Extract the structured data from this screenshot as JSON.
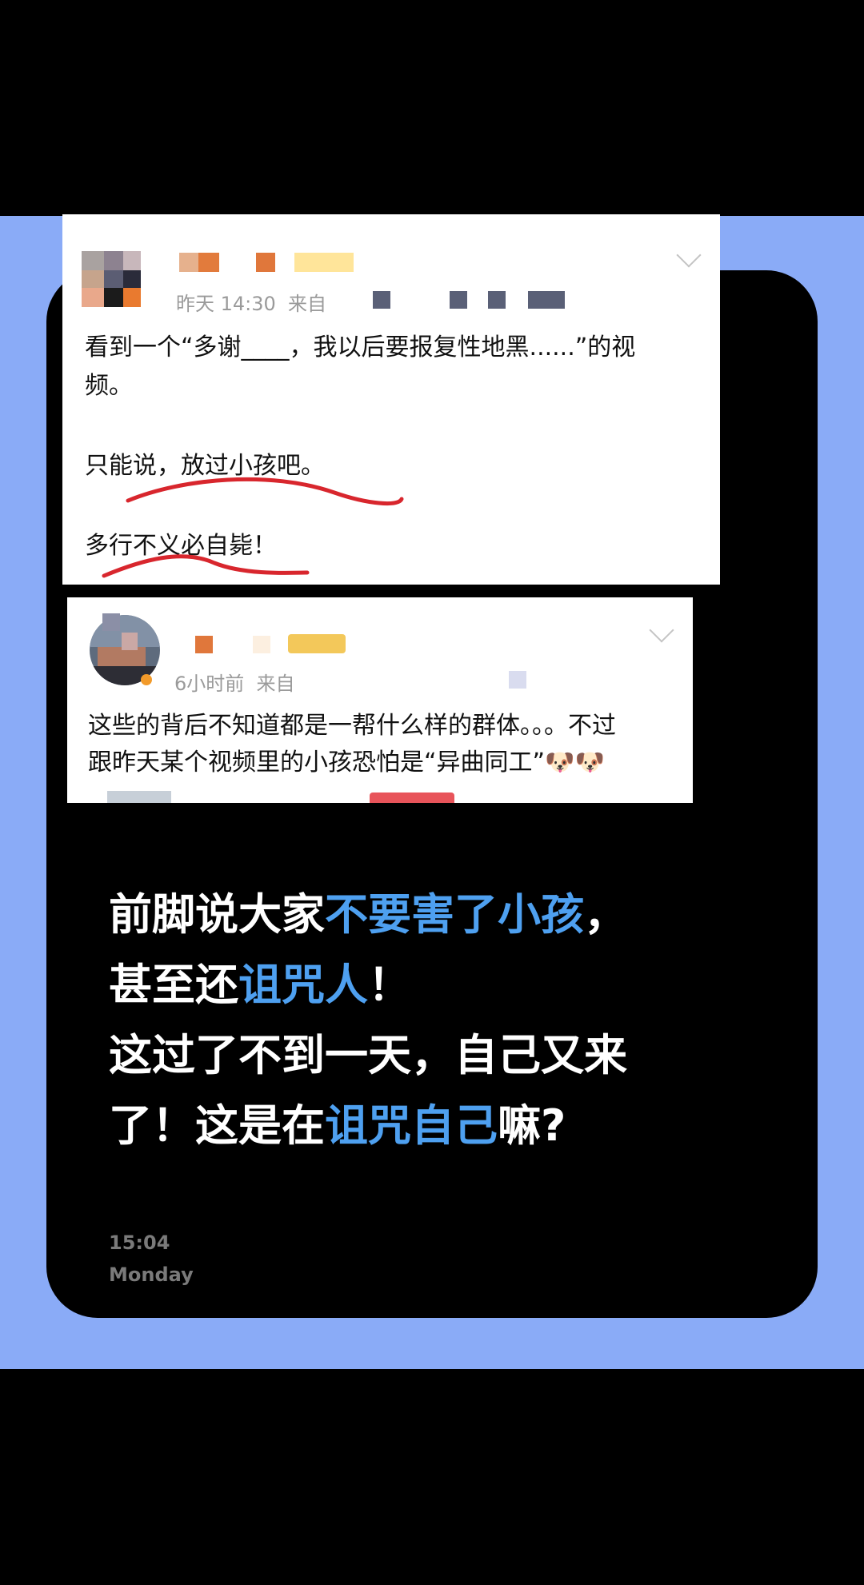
{
  "post1": {
    "meta": "昨天 14:30  来自",
    "line1": "看到一个“多谢____，我以后要报复性地黑......”的视",
    "line2": "频。",
    "line3": "只能说，放过小孩吧。",
    "line4": "多行不义必自毙！"
  },
  "post2": {
    "meta": "6小时前  来自",
    "line1": "这些的背后不知道都是一帮什么样的群体。。。不过",
    "line2": "跟昨天某个视频里的小孩恐怕是“异曲同工”",
    "emoji": "🐶🐶"
  },
  "headline": {
    "l1a": "前脚说大家",
    "l1b": "不要害了小孩",
    "l1c": "，",
    "l2a": "甚至还",
    "l2b": "诅咒人",
    "l2c": "！",
    "l3": "这过了不到一天，自己又来",
    "l4a": "了！这是在",
    "l4b": "诅咒自己",
    "l4c": "嘛?"
  },
  "clock": {
    "time": "15:04",
    "day": "Monday"
  },
  "colors": {
    "band": "#8aabf7",
    "highlight": "#4ea0f0",
    "underline": "#d8262d"
  }
}
